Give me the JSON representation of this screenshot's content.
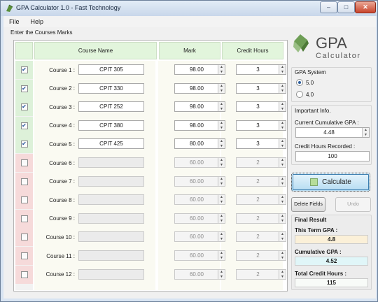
{
  "window": {
    "title": "GPA Calculator 1.0 - Fast Technology",
    "min_glyph": "–",
    "max_glyph": "□",
    "close_glyph": "✕"
  },
  "menu": [
    {
      "label": "File"
    },
    {
      "label": "Help"
    }
  ],
  "courses_group": {
    "title": "Enter the Courses Marks"
  },
  "table": {
    "headers": {
      "name": "Course Name",
      "mark": "Mark",
      "hours": "Credit Hours"
    },
    "rows": [
      {
        "label": "Course 1 :",
        "checked": true,
        "name": "CPIT 305",
        "mark": "98.00",
        "hours": "3"
      },
      {
        "label": "Course 2 :",
        "checked": true,
        "name": "CPIT 330",
        "mark": "98.00",
        "hours": "3"
      },
      {
        "label": "Course 3 :",
        "checked": true,
        "name": "CPIT 252",
        "mark": "98.00",
        "hours": "3"
      },
      {
        "label": "Course 4 :",
        "checked": true,
        "name": "CPIT 380",
        "mark": "98.00",
        "hours": "3"
      },
      {
        "label": "Course 5 :",
        "checked": true,
        "name": "CPIT 425",
        "mark": "80.00",
        "hours": "3"
      },
      {
        "label": "Course 6 :",
        "checked": false,
        "name": "",
        "mark": "60.00",
        "hours": "2"
      },
      {
        "label": "Course 7 :",
        "checked": false,
        "name": "",
        "mark": "60.00",
        "hours": "2"
      },
      {
        "label": "Course 8 :",
        "checked": false,
        "name": "",
        "mark": "60.00",
        "hours": "2"
      },
      {
        "label": "Course 9 :",
        "checked": false,
        "name": "",
        "mark": "60.00",
        "hours": "2"
      },
      {
        "label": "Course 10 :",
        "checked": false,
        "name": "",
        "mark": "60.00",
        "hours": "2"
      },
      {
        "label": "Course 11 :",
        "checked": false,
        "name": "",
        "mark": "60.00",
        "hours": "2"
      },
      {
        "label": "Course 12 :",
        "checked": false,
        "name": "",
        "mark": "60.00",
        "hours": "2"
      }
    ]
  },
  "logo": {
    "big": "GPA",
    "small": "Calculator"
  },
  "gpa_system": {
    "title": "GPA System",
    "options": [
      {
        "label": "5.0",
        "selected": true
      },
      {
        "label": "4.0",
        "selected": false
      }
    ]
  },
  "info": {
    "title": "Important Info.",
    "cum_label": "Current Cumulative GPA :",
    "cum_value": "4.48",
    "hours_label": "Credit Hours Recorded :",
    "hours_value": "100"
  },
  "buttons": {
    "calculate": "Calculate",
    "delete": "Delete Fields",
    "undo": "Undo"
  },
  "result": {
    "title": "Final Result",
    "term_label": "This Term GPA :",
    "term_value": "4.8",
    "cum_label": "Cumulative GPA :",
    "cum_value": "4.52",
    "hours_label": "Total Credit Hours :",
    "hours_value": "115"
  },
  "colors": {
    "checked_bg": "#ddf1d9",
    "unchecked_bg": "#f6dada",
    "header_bg": "#e2f5dc",
    "accent": "#3c7fb1"
  }
}
